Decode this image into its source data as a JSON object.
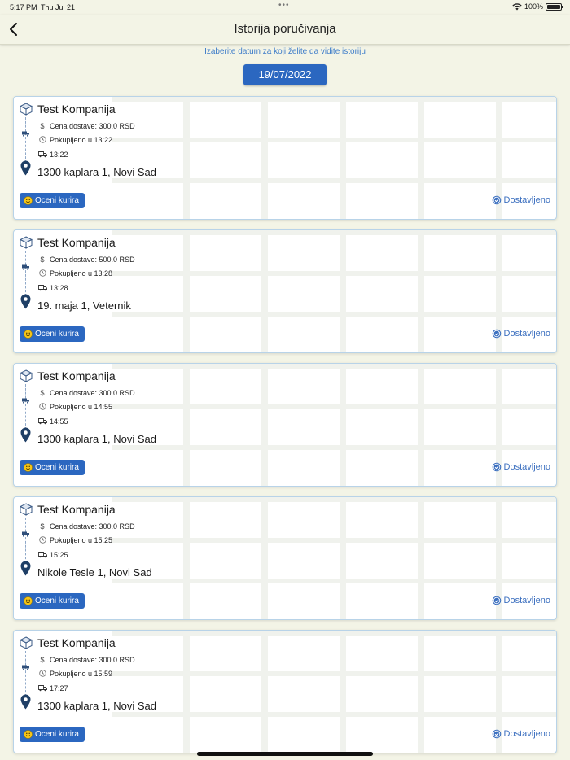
{
  "status_bar": {
    "time": "5:17 PM",
    "date": "Thu Jul 21",
    "battery": "100%"
  },
  "header": {
    "title": "Istorija poručivanja"
  },
  "hint": "Izaberite datum za koji želite da vidite istoriju",
  "date_picker": {
    "value": "19/07/2022"
  },
  "colors": {
    "accent": "#2b67c0",
    "status": "#3b6fbf",
    "background": "#f3f4e6"
  },
  "orders": [
    {
      "company": "Test Kompanija",
      "price": "Cena dostave: 300.0 RSD",
      "pickup": "Pokupljeno u 13:22",
      "delivered": "13:22",
      "address": "1300 kaplara 1, Novi Sad",
      "rate_label": "Oceni kurira",
      "status": "Dostavljeno"
    },
    {
      "company": "Test Kompanija",
      "price": "Cena dostave: 500.0 RSD",
      "pickup": "Pokupljeno u 13:28",
      "delivered": "13:28",
      "address": "19. maja 1, Veternik",
      "rate_label": "Oceni kurira",
      "status": "Dostavljeno"
    },
    {
      "company": "Test Kompanija",
      "price": "Cena dostave: 300.0 RSD",
      "pickup": "Pokupljeno u 14:55",
      "delivered": "14:55",
      "address": "1300 kaplara 1, Novi Sad",
      "rate_label": "Oceni kurira",
      "status": "Dostavljeno"
    },
    {
      "company": "Test Kompanija",
      "price": "Cena dostave: 300.0 RSD",
      "pickup": "Pokupljeno u 15:25",
      "delivered": "15:25",
      "address": "Nikole Tesle 1, Novi Sad",
      "rate_label": "Oceni kurira",
      "status": "Dostavljeno"
    },
    {
      "company": "Test Kompanija",
      "price": "Cena dostave: 300.0 RSD",
      "pickup": "Pokupljeno u 15:59",
      "delivered": "17:27",
      "address": "1300 kaplara 1, Novi Sad",
      "rate_label": "Oceni kurira",
      "status": "Dostavljeno"
    }
  ]
}
